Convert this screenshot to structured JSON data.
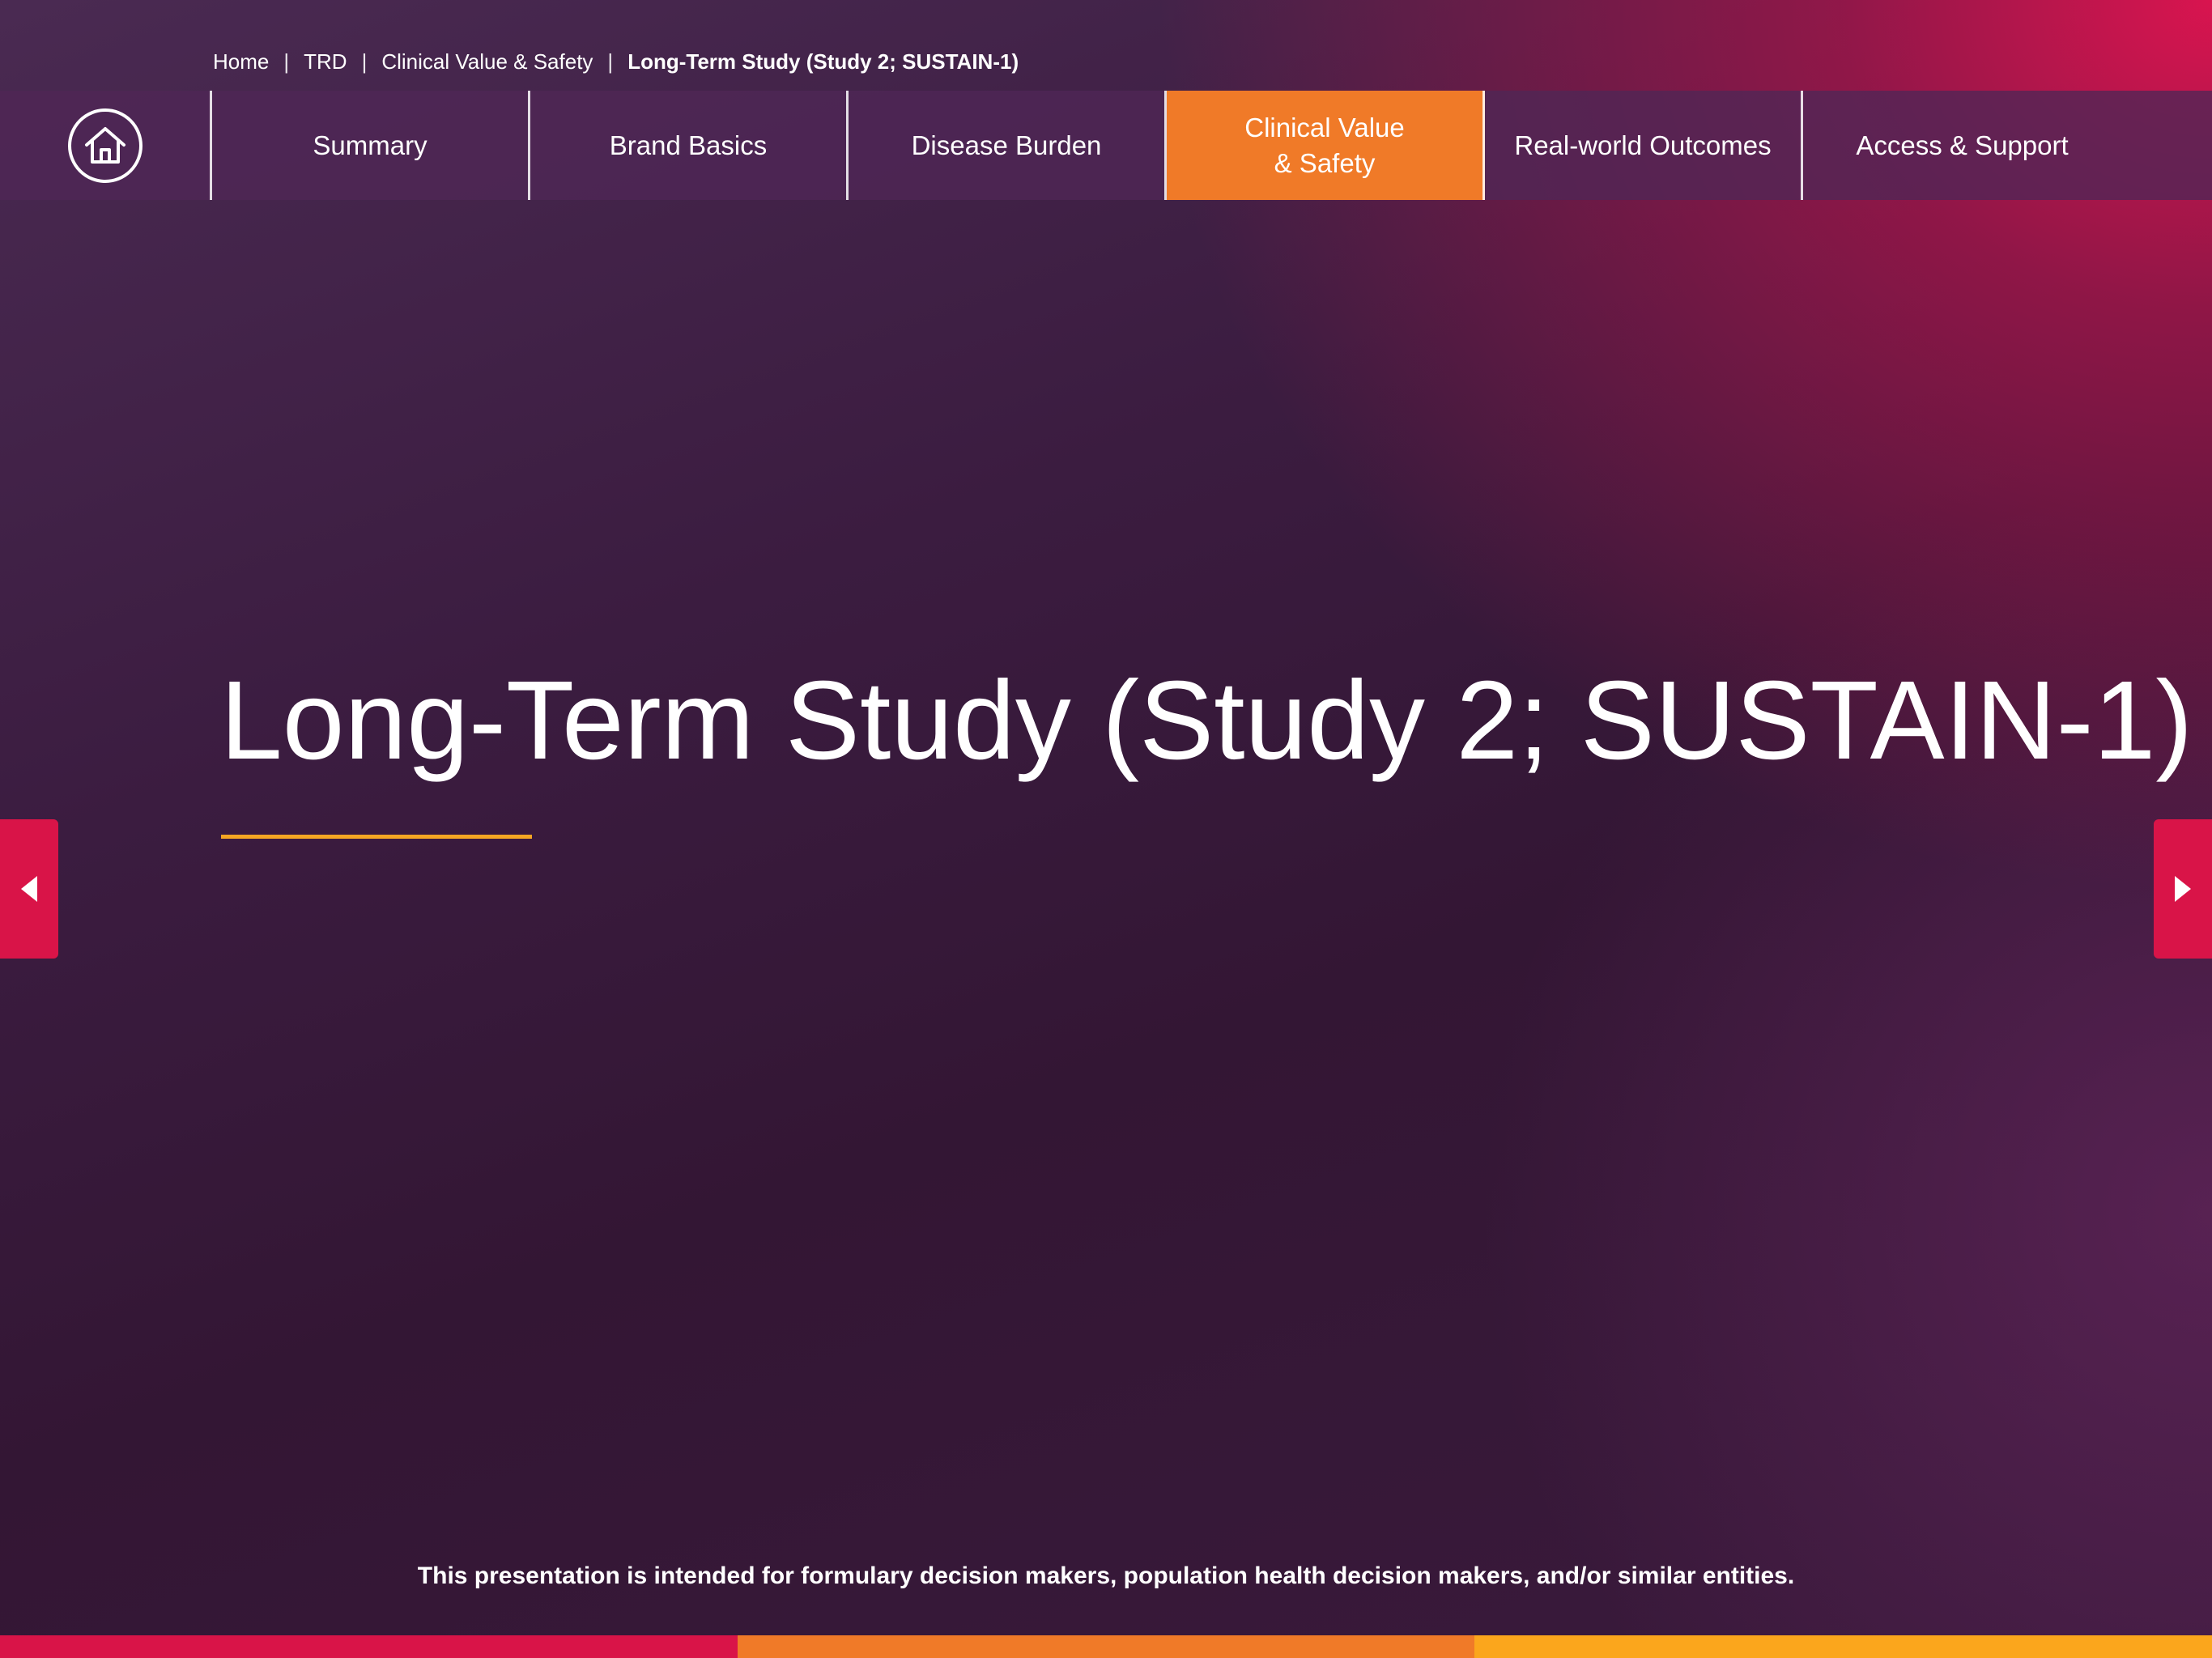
{
  "breadcrumb": {
    "items": [
      "Home",
      "TRD",
      "Clinical Value & Safety"
    ],
    "separator": "|",
    "current": "Long-Term Study (Study 2; SUSTAIN-1)"
  },
  "nav": {
    "home_icon": "home-icon",
    "items": [
      {
        "label": "Summary"
      },
      {
        "label": "Brand Basics"
      },
      {
        "label": "Disease Burden"
      },
      {
        "label": "Clinical Value\n& Safety",
        "active": true
      },
      {
        "label": "Real-world Outcomes"
      },
      {
        "label": "Access & Support"
      }
    ]
  },
  "page": {
    "title": "Long-Term Study (Study 2; SUSTAIN-1)",
    "disclaimer": "This presentation is intended for formulary decision makers, population health decision makers, and/or similar entities."
  },
  "controls": {
    "prev_icon": "triangle-left-icon",
    "next_icon": "triangle-right-icon"
  },
  "colors": {
    "active_tab": "#f07a28",
    "accent_rule": "#f5a623",
    "arrow_bg": "#d91448",
    "footer": [
      "#d91448",
      "#f07a28",
      "#fba61c"
    ]
  }
}
